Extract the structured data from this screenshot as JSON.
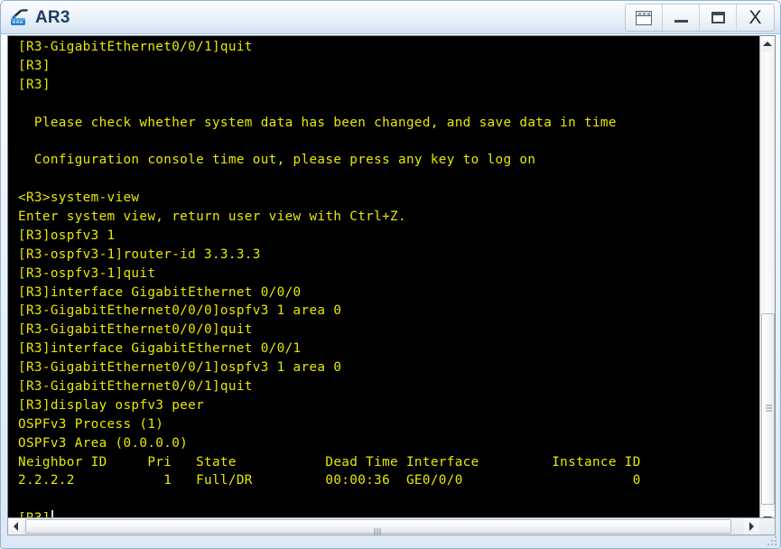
{
  "window": {
    "title": "AR3",
    "app_icon": "router-icon",
    "buttons": [
      {
        "name": "restore-window-button",
        "icon": "restore-window-icon",
        "label": ""
      },
      {
        "name": "minimize-button",
        "icon": "minimize-icon",
        "label": ""
      },
      {
        "name": "maximize-button",
        "icon": "maximize-icon",
        "label": ""
      },
      {
        "name": "close-button",
        "icon": "close-icon",
        "label": "X"
      }
    ]
  },
  "terminal": {
    "foreground_color": "#e8e800",
    "background_color": "#000000",
    "cursor_visible": true,
    "lines": [
      "[R3-GigabitEthernet0/0/1]quit",
      "[R3]",
      "[R3]",
      "",
      "  Please check whether system data has been changed, and save data in time",
      "",
      "  Configuration console time out, please press any key to log on",
      "",
      "<R3>system-view",
      "Enter system view, return user view with Ctrl+Z.",
      "[R3]ospfv3 1",
      "[R3-ospfv3-1]router-id 3.3.3.3",
      "[R3-ospfv3-1]quit",
      "[R3]interface GigabitEthernet 0/0/0",
      "[R3-GigabitEthernet0/0/0]ospfv3 1 area 0",
      "[R3-GigabitEthernet0/0/0]quit",
      "[R3]interface GigabitEthernet 0/0/1",
      "[R3-GigabitEthernet0/0/1]ospfv3 1 area 0",
      "[R3-GigabitEthernet0/0/1]quit",
      "[R3]display ospfv3 peer",
      "OSPFv3 Process (1)",
      "OSPFv3 Area (0.0.0.0)",
      "Neighbor ID     Pri   State           Dead Time Interface         Instance ID",
      "2.2.2.2           1   Full/DR         00:00:36  GE0/0/0                     0",
      ""
    ],
    "prompt_line": "[R3]",
    "peer_table": {
      "process": "OSPFv3 Process (1)",
      "area": "OSPFv3 Area (0.0.0.0)",
      "columns": [
        "Neighbor ID",
        "Pri",
        "State",
        "Dead Time",
        "Interface",
        "Instance ID"
      ],
      "rows": [
        [
          "2.2.2.2",
          "1",
          "Full/DR",
          "00:00:36",
          "GE0/0/0",
          "0"
        ]
      ]
    }
  },
  "scrollbars": {
    "vertical": {
      "up_icon": "arrow-up-icon",
      "down_icon": "arrow-down-icon",
      "thumb": "vertical-scroll-thumb"
    },
    "horizontal": {
      "left_icon": "arrow-left-icon",
      "right_icon": "arrow-right-icon",
      "thumb": "horizontal-scroll-thumb"
    }
  }
}
